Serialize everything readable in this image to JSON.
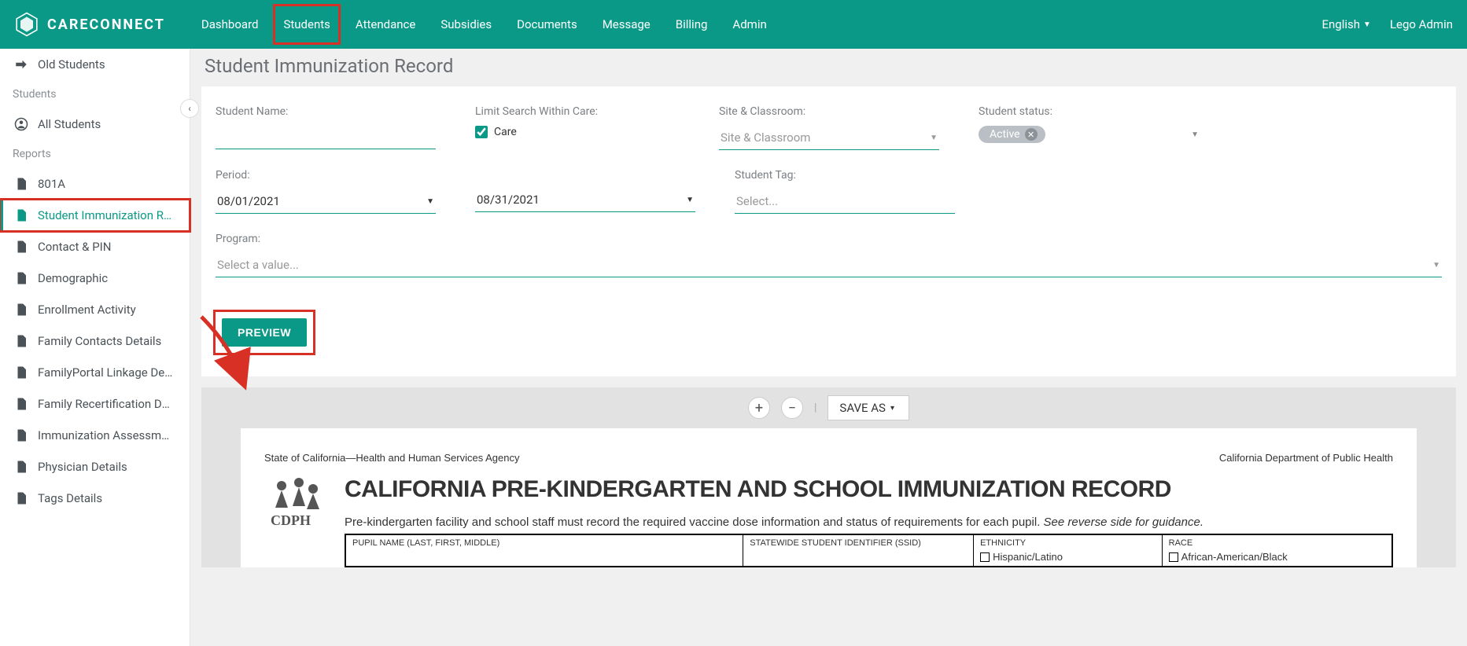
{
  "brand": "CARECONNECT",
  "nav": {
    "items": [
      "Dashboard",
      "Students",
      "Attendance",
      "Subsidies",
      "Documents",
      "Message",
      "Billing",
      "Admin"
    ],
    "language": "English",
    "user": "Lego Admin"
  },
  "sidebar": {
    "old_students": "Old Students",
    "section_students": "Students",
    "all_students": "All Students",
    "section_reports": "Reports",
    "reports": [
      "801A",
      "Student Immunization Reco…",
      "Contact & PIN",
      "Demographic",
      "Enrollment Activity",
      "Family Contacts Details",
      "FamilyPortal Linkage Details",
      "Family Recertification Date",
      "Immunization Assessment",
      "Physician Details",
      "Tags Details"
    ]
  },
  "page": {
    "title": "Student Immunization Record"
  },
  "filters": {
    "student_name_label": "Student Name:",
    "limit_search_label": "Limit Search Within Care:",
    "care_label": "Care",
    "site_classroom_label": "Site & Classroom:",
    "site_classroom_placeholder": "Site & Classroom",
    "student_status_label": "Student status:",
    "status_chip": "Active",
    "period_label": "Period:",
    "period_start": "08/01/2021",
    "period_end": "08/31/2021",
    "student_tag_label": "Student Tag:",
    "student_tag_placeholder": "Select...",
    "program_label": "Program:",
    "program_placeholder": "Select a value...",
    "preview_btn": "PREVIEW"
  },
  "report_toolbar": {
    "save_as": "SAVE AS"
  },
  "report": {
    "header_left": "State of California—Health and Human Services Agency",
    "header_right": "California Department of Public Health",
    "title": "CALIFORNIA PRE-KINDERGARTEN AND SCHOOL IMMUNIZATION RECORD",
    "subtitle_plain": "Pre-kindergarten facility and school staff must record the required vaccine dose information and status of requirements for each pupil. ",
    "subtitle_italic": "See reverse side for guidance.",
    "cells": {
      "pupil_name": "PUPIL NAME (LAST, FIRST, MIDDLE)",
      "ssid": "STATEWIDE STUDENT IDENTIFIER (SSID)",
      "ethnicity": "ETHNICITY",
      "ethnicity_opt": "Hispanic/Latino",
      "race": "RACE",
      "race_opt": "African-American/Black"
    }
  }
}
